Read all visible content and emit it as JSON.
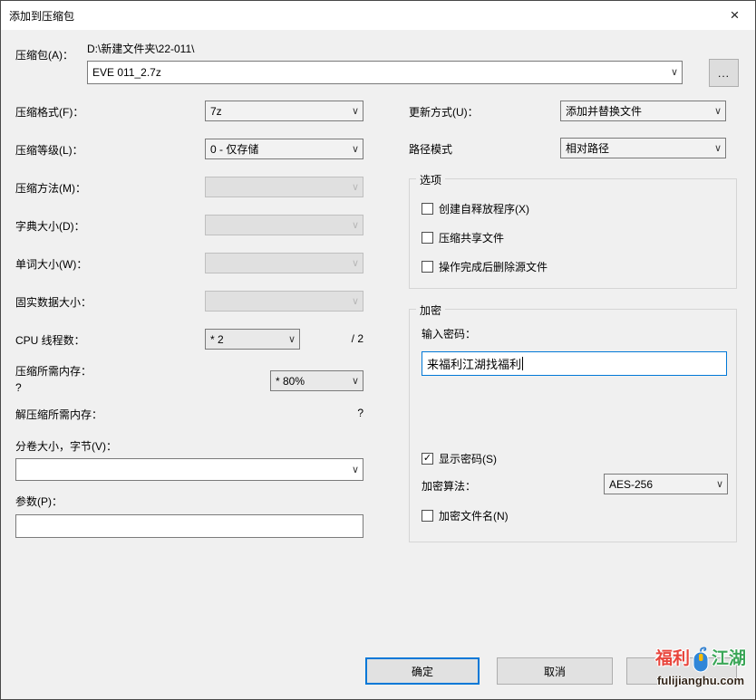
{
  "window": {
    "title": "添加到压缩包"
  },
  "icons": {
    "close": "×",
    "chevron": "∨",
    "check": "✓",
    "browse": "..."
  },
  "archive": {
    "label": "压缩包(A)：",
    "dir_path": "D:\\新建文件夹\\22-011\\",
    "name_value": "EVE 011_2.7z"
  },
  "compression": {
    "rows": [
      {
        "label": "压缩格式(F)：",
        "value": "7z",
        "disabled": false
      },
      {
        "label": "压缩等级(L)：",
        "value": "0 - 仅存储",
        "disabled": false
      },
      {
        "label": "压缩方法(M)：",
        "value": "",
        "disabled": true
      },
      {
        "label": "字典大小(D)：",
        "value": "",
        "disabled": true
      },
      {
        "label": "单词大小(W)：",
        "value": "",
        "disabled": true
      },
      {
        "label": "固实数据大小：",
        "value": "",
        "disabled": true
      }
    ],
    "threads": {
      "label": "CPU 线程数：",
      "value": "* 2",
      "max": "/ 2"
    },
    "memory_compress": {
      "label": "压缩所需内存：",
      "hint": "?",
      "value": "* 80%"
    },
    "memory_decompress": {
      "label": "解压缩所需内存：",
      "hint": "?"
    },
    "volume": {
      "label": "分卷大小，字节(V)：",
      "value": ""
    },
    "params": {
      "label": "参数(P)：",
      "value": ""
    }
  },
  "right": {
    "update_mode": {
      "label": "更新方式(U)：",
      "value": "添加并替换文件"
    },
    "path_mode": {
      "label": "路径模式",
      "value": "相对路径"
    },
    "options_group": {
      "title": "选项",
      "checkboxes": [
        {
          "label": "创建自释放程序(X)",
          "checked": false
        },
        {
          "label": "压缩共享文件",
          "checked": false
        },
        {
          "label": "操作完成后删除源文件",
          "checked": false
        }
      ]
    },
    "encryption_group": {
      "title": "加密",
      "password_label": "输入密码：",
      "password_value": "来福利江湖找福利",
      "show_password": {
        "label": "显示密码(S)",
        "checked": true
      },
      "method_label": "加密算法：",
      "method_value": "AES-256",
      "encrypt_names": {
        "label": "加密文件名(N)",
        "checked": false
      }
    }
  },
  "buttons": {
    "ok": "确定",
    "cancel": "取消"
  },
  "watermark": {
    "brand_left": "福利",
    "brand_right": "江湖",
    "domain": "fulijianghu.com"
  }
}
